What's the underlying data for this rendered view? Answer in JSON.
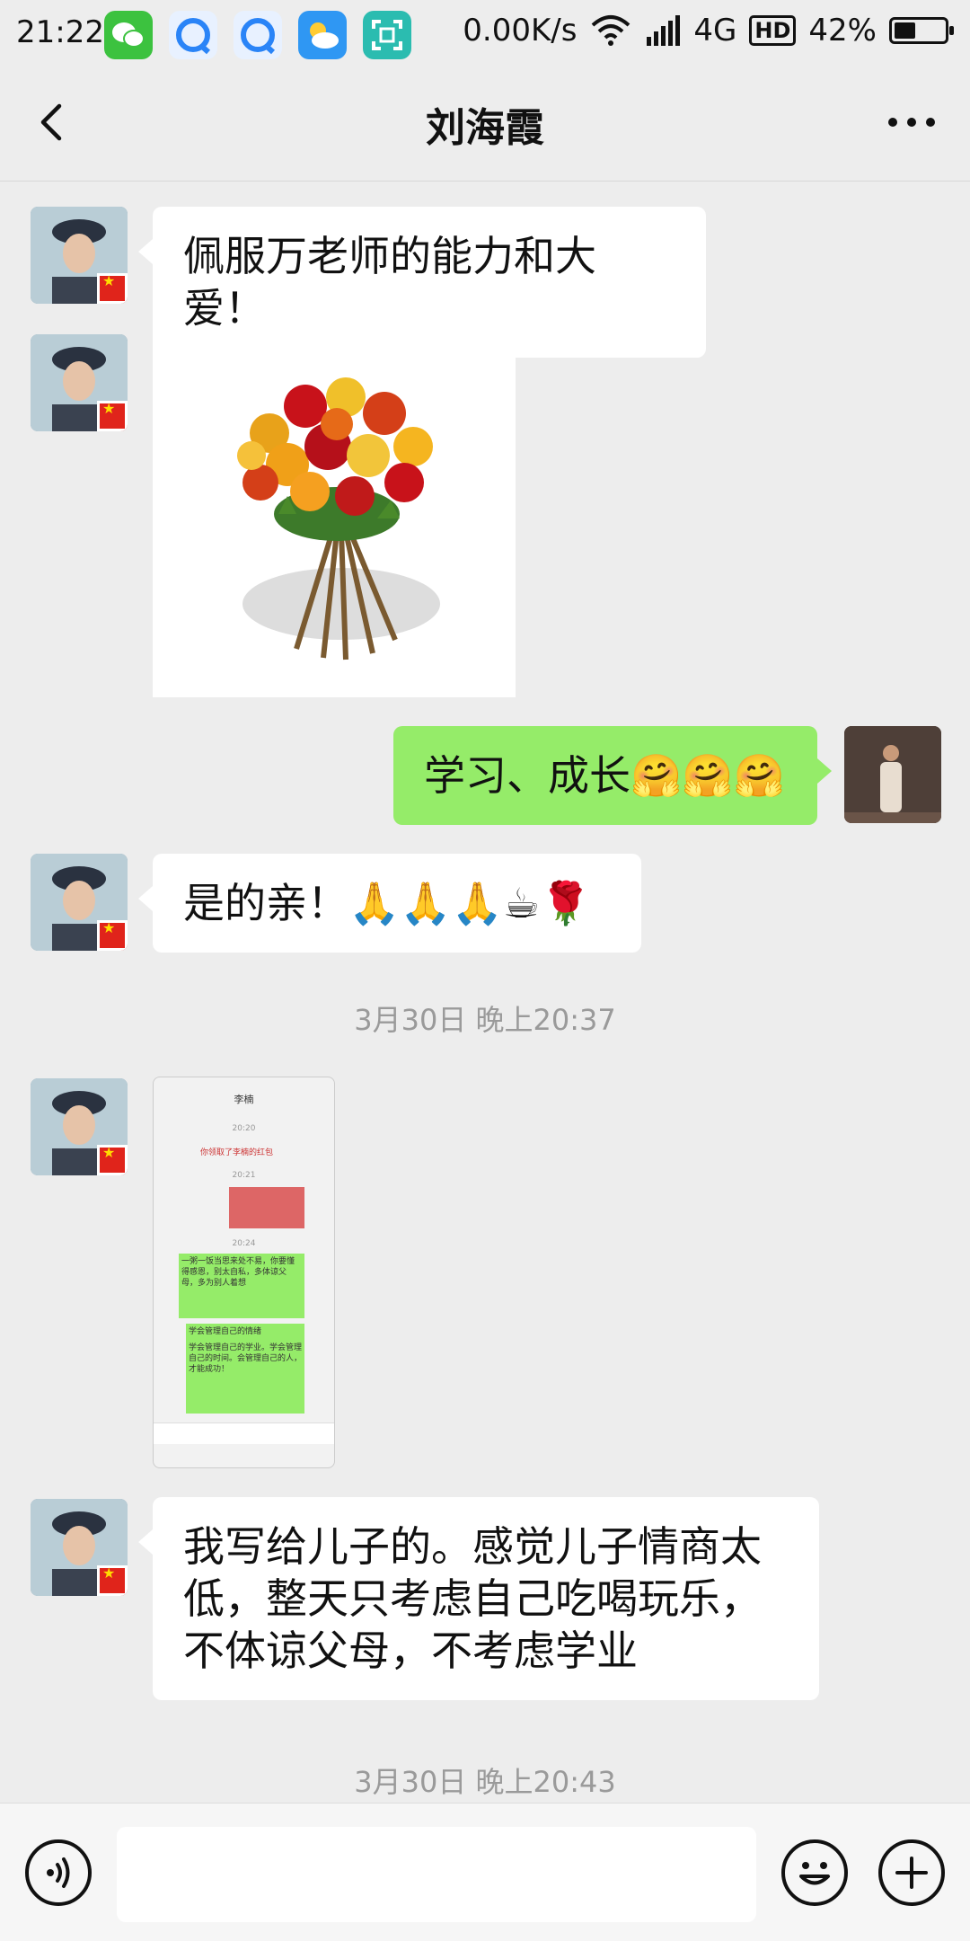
{
  "status_bar": {
    "time": "21:22",
    "net_speed": "0.00K/s",
    "network_type": "4G",
    "hd_badge": "HD",
    "battery_percent": "42%",
    "battery_level": 0.42
  },
  "header": {
    "title": "刘海霞"
  },
  "messages": [
    {
      "sender": "contact",
      "type": "text",
      "text": "佩服万老师的能力和大爱！"
    },
    {
      "sender": "contact",
      "type": "image",
      "image_desc": "flower-bouquet"
    },
    {
      "sender": "me",
      "type": "text",
      "text": "学习、成长🤗🤗🤗"
    },
    {
      "sender": "contact",
      "type": "text",
      "text": "是的亲！🙏🙏🙏☕🌹"
    },
    {
      "type": "timestamp",
      "text": "3月30日 晚上20:37"
    },
    {
      "sender": "contact",
      "type": "image",
      "image_desc": "chat-screenshot"
    },
    {
      "sender": "contact",
      "type": "text",
      "text": "我写给儿子的。感觉儿子情商太低，整天只考虑自己吃喝玩乐，不体谅父母，不考虑学业"
    },
    {
      "type": "timestamp",
      "text": "3月30日 晚上20:43"
    }
  ],
  "screenshot_thumb": {
    "title": "李楠",
    "time1": "20:20",
    "time2": "20:21",
    "time3": "20:24",
    "red_packet": "你领取了李楠的红包",
    "msg1": "一粥一饭当思来处不易，你要懂得感恩，别太自私，多体谅父母，多为别人着想",
    "msg2_title": "学会管理自己的情绪",
    "msg2_body": "学会管理自己的学业。学会管理自己的时间。会管理自己的人，才能成功！"
  },
  "input_bar": {
    "voice_icon": "voice-icon",
    "emoji_icon": "emoji-icon",
    "plus_icon": "plus-icon"
  },
  "colors": {
    "background": "#ededed",
    "sent_bubble": "#95ec69",
    "received_bubble": "#ffffff",
    "timestamp": "#9a9a9a"
  }
}
